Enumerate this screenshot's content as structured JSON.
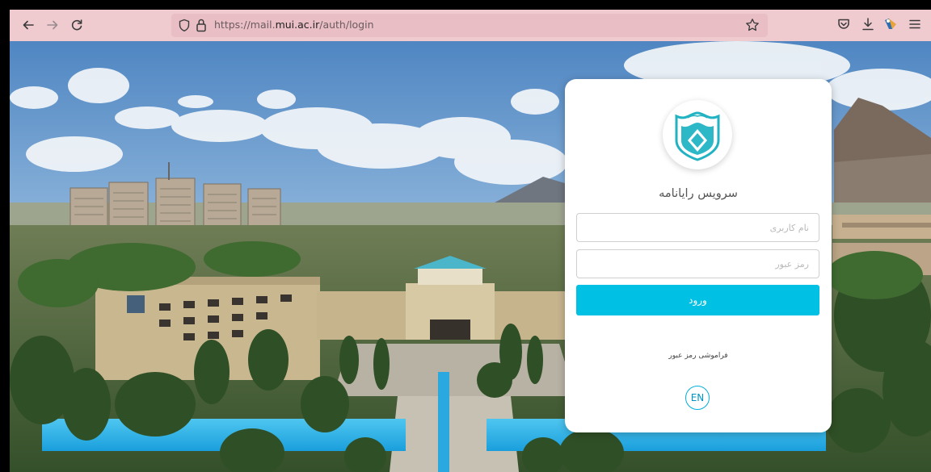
{
  "browser": {
    "url_prefix": "https://mail.",
    "url_domain": "mui.ac.ir",
    "url_path": "/auth/login"
  },
  "login": {
    "title": "سرویس رایانامه",
    "username_placeholder": "نام کاربری",
    "password_placeholder": "رمز عبور",
    "submit_label": "ورود",
    "forgot_label": "فراموشی رمز عبور",
    "language_label": "EN"
  },
  "colors": {
    "accent": "#00c0e4",
    "toolbar_background": "#efcbd0"
  }
}
